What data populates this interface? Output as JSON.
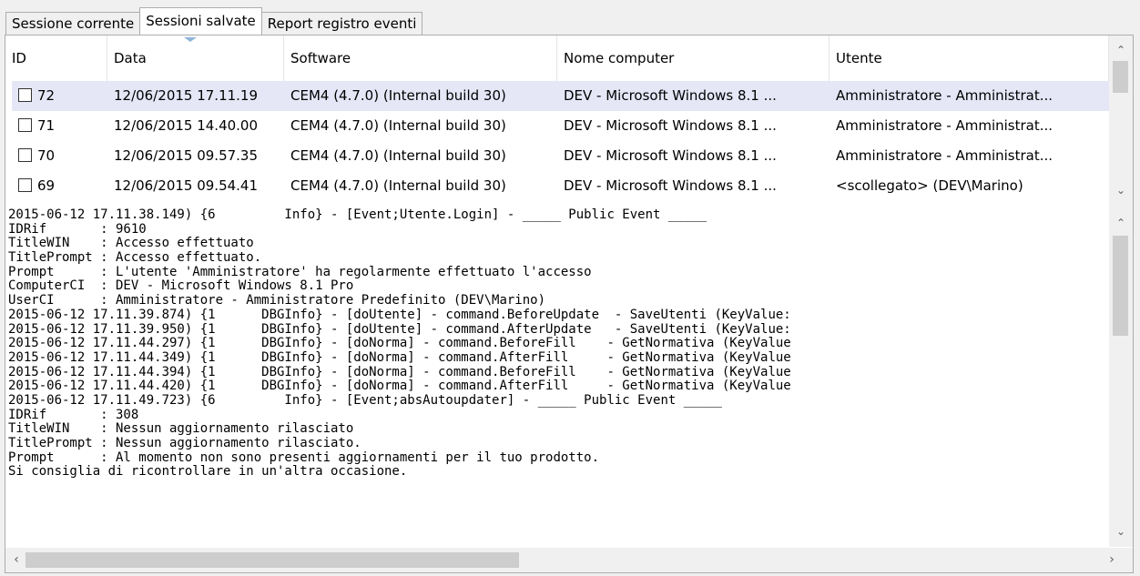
{
  "tabs": [
    {
      "label": "Sessione corrente"
    },
    {
      "label": "Sessioni salvate"
    },
    {
      "label": "Report registro eventi"
    }
  ],
  "grid": {
    "columns": [
      "ID",
      "Data",
      "Software",
      "Nome computer",
      "Utente"
    ],
    "rows": [
      {
        "id": "72",
        "data": "12/06/2015 17.11.19",
        "software": "CEM4 (4.7.0) (Internal build 30)",
        "computer": "DEV - Microsoft Windows 8.1 ...",
        "utente": "Amministratore - Amministrat...",
        "selected": true
      },
      {
        "id": "71",
        "data": "12/06/2015 14.40.00",
        "software": "CEM4 (4.7.0) (Internal build 30)",
        "computer": "DEV - Microsoft Windows 8.1 ...",
        "utente": "Amministratore - Amministrat..."
      },
      {
        "id": "70",
        "data": "12/06/2015 09.57.35",
        "software": "CEM4 (4.7.0) (Internal build 30)",
        "computer": "DEV - Microsoft Windows 8.1 ...",
        "utente": "Amministratore - Amministrat..."
      },
      {
        "id": "69",
        "data": "12/06/2015 09.54.41",
        "software": "CEM4 (4.7.0) (Internal build 30)",
        "computer": "DEV - Microsoft Windows 8.1 ...",
        "utente": "<scollegato> (DEV\\Marino)"
      }
    ]
  },
  "log": {
    "lines": [
      "2015-06-12 17.11.38.149) {6         Info} - [Event;Utente.Login] - _____ Public Event _____",
      "IDRif       : 9610",
      "TitleWIN    : Accesso effettuato",
      "TitlePrompt : Accesso effettuato.",
      "Prompt      : L'utente 'Amministratore' ha regolarmente effettuato l'accesso",
      "ComputerCI  : DEV - Microsoft Windows 8.1 Pro",
      "UserCI      : Amministratore - Amministratore Predefinito (DEV\\Marino)",
      "2015-06-12 17.11.39.874) {1      DBGInfo} - [doUtente] - command.BeforeUpdate  - SaveUtenti (KeyValue:",
      "2015-06-12 17.11.39.950) {1      DBGInfo} - [doUtente] - command.AfterUpdate   - SaveUtenti (KeyValue:",
      "2015-06-12 17.11.44.297) {1      DBGInfo} - [doNorma] - command.BeforeFill    - GetNormativa (KeyValue",
      "2015-06-12 17.11.44.349) {1      DBGInfo} - [doNorma] - command.AfterFill     - GetNormativa (KeyValue",
      "2015-06-12 17.11.44.394) {1      DBGInfo} - [doNorma] - command.BeforeFill    - GetNormativa (KeyValue",
      "2015-06-12 17.11.44.420) {1      DBGInfo} - [doNorma] - command.AfterFill     - GetNormativa (KeyValue",
      "2015-06-12 17.11.49.723) {6         Info} - [Event;absAutoupdater] - _____ Public Event _____",
      "IDRif       : 308",
      "TitleWIN    : Nessun aggiornamento rilasciato",
      "TitlePrompt : Nessun aggiornamento rilasciato.",
      "Prompt      : Al momento non sono presenti aggiornamenti per il tuo prodotto.",
      "Si consiglia di ricontrollare in un'altra occasione."
    ]
  },
  "icons": {
    "scroll_up": "chevron-up-icon",
    "scroll_down": "chevron-down-icon",
    "scroll_left": "chevron-left-icon",
    "scroll_right": "chevron-right-icon",
    "sort": "sort-indicator-icon"
  },
  "colors": {
    "selected_row": "#e5e7f7",
    "scroll_thumb": "#cdcdcd"
  }
}
